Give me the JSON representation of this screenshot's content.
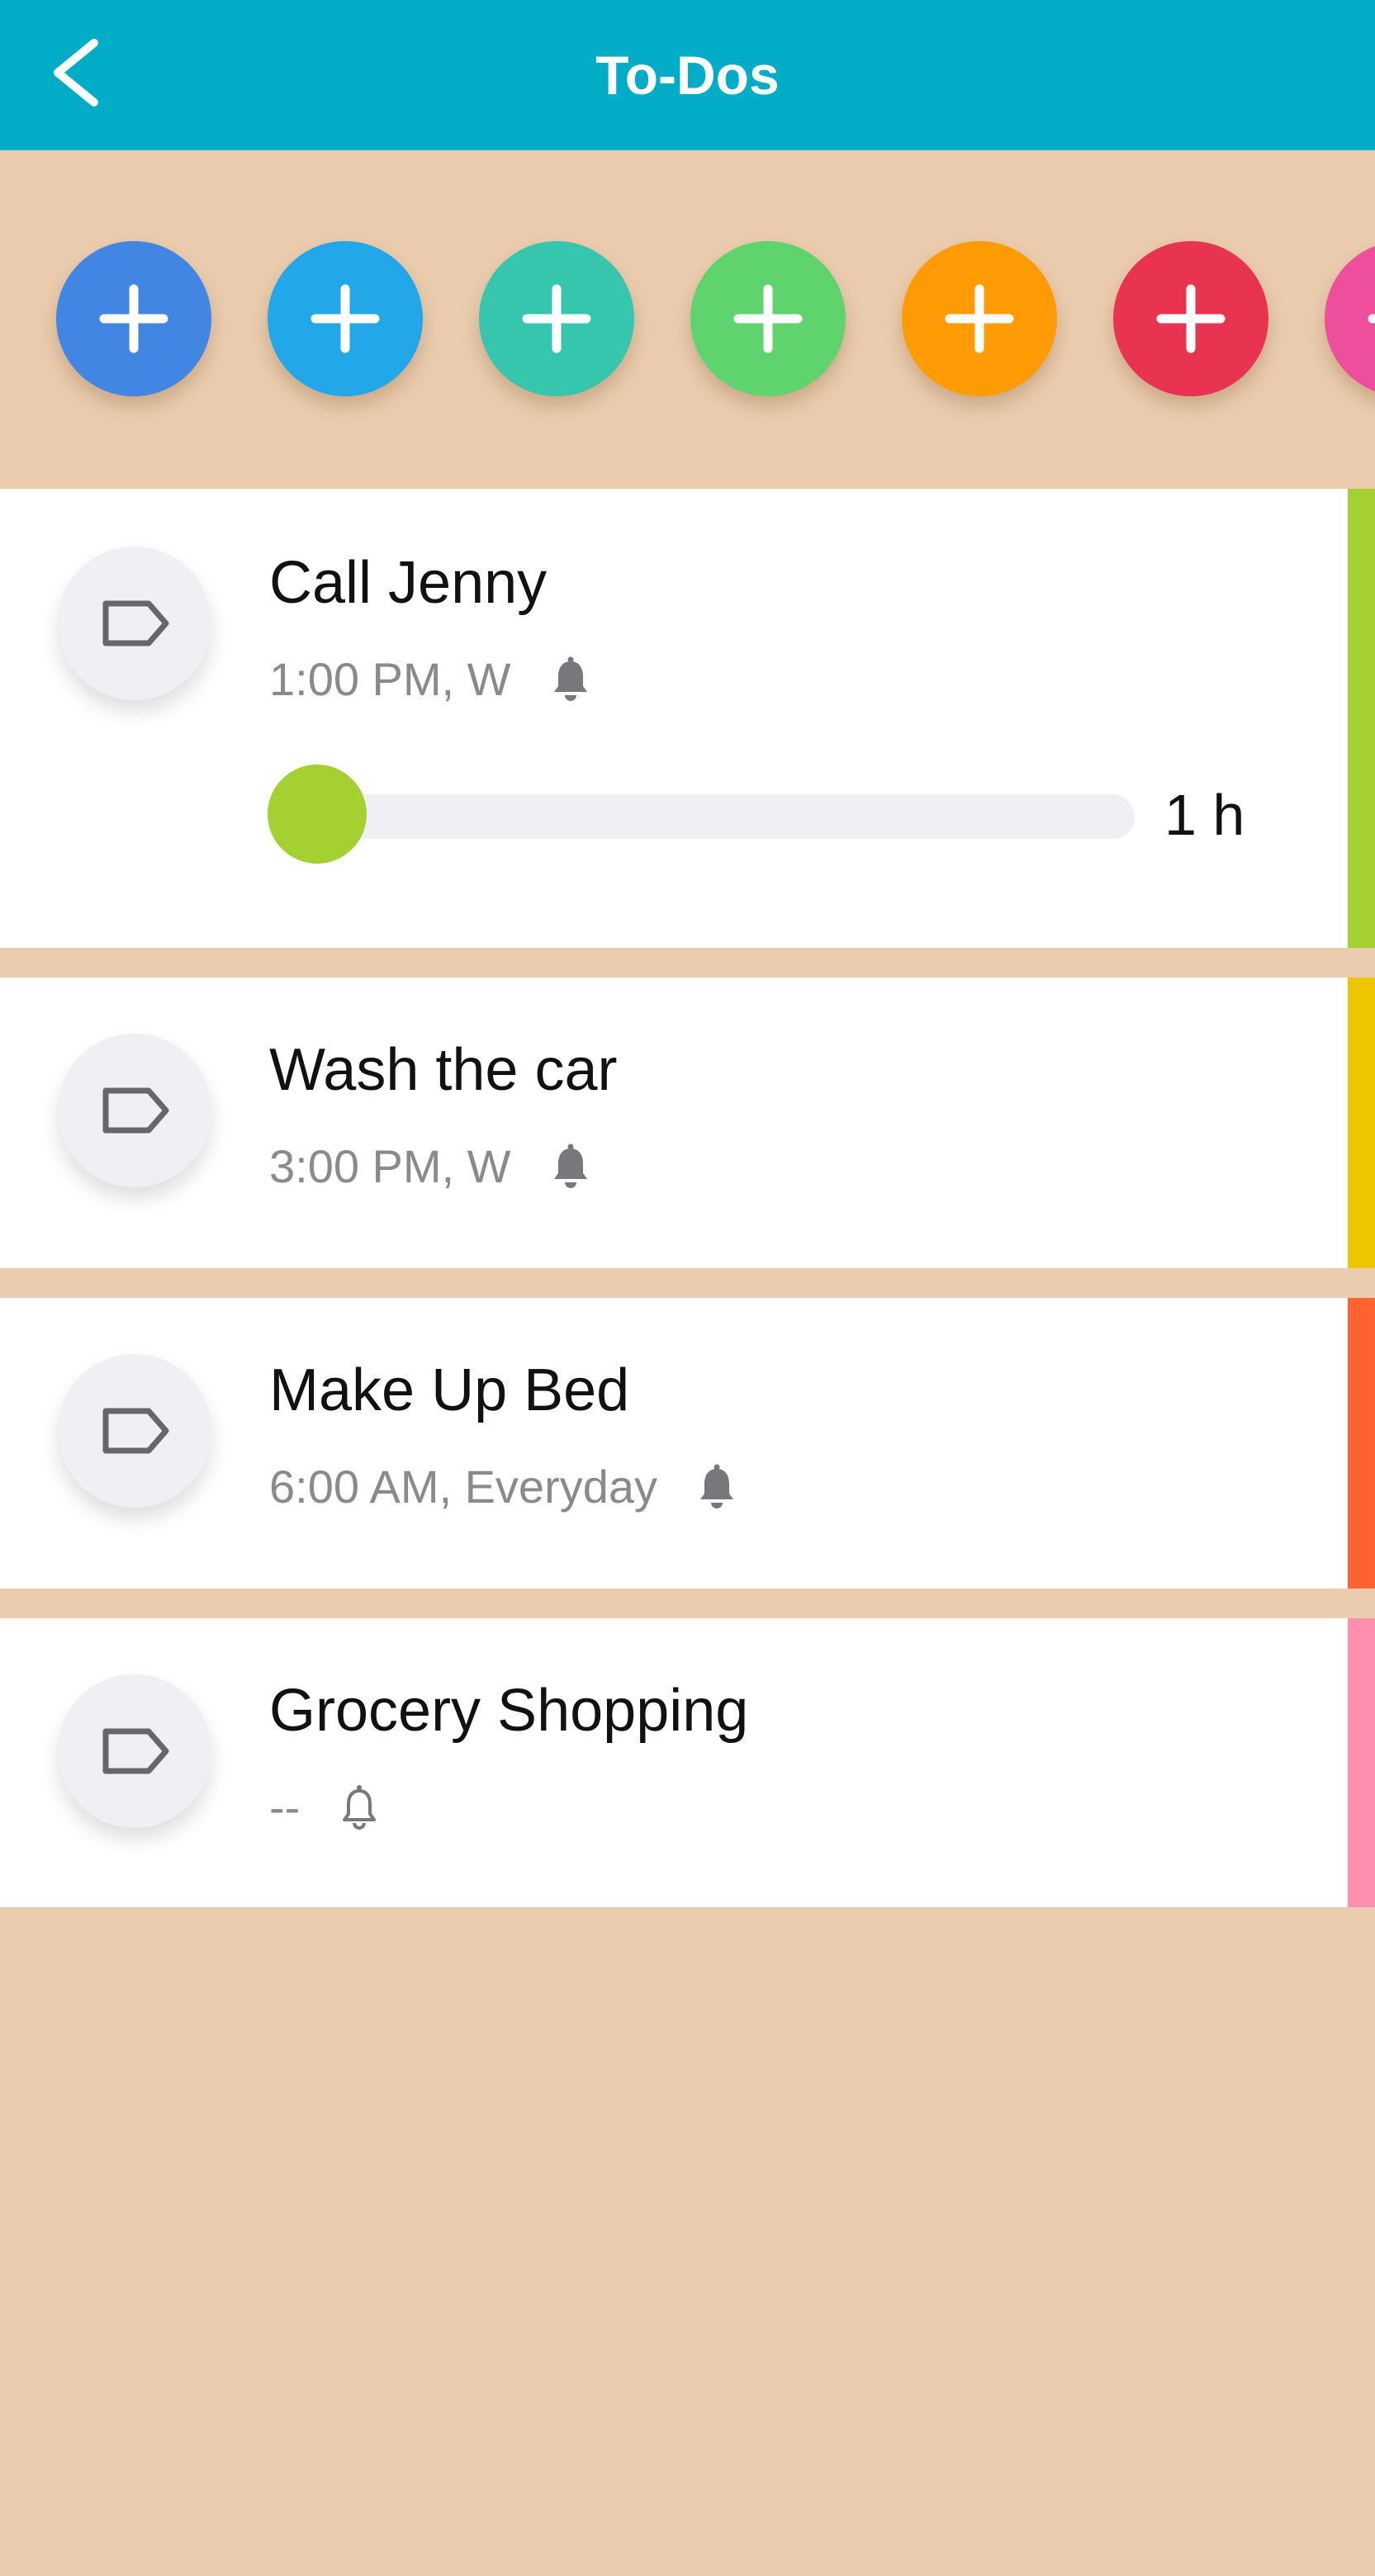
{
  "header": {
    "title": "To-Dos",
    "back_icon": "chevron-left-icon",
    "background": "#00ACC6"
  },
  "color_strip": {
    "background": "#EBCCAE",
    "buttons": [
      {
        "color": "#4186E2",
        "icon": "plus-icon"
      },
      {
        "color": "#22A8E8",
        "icon": "plus-icon"
      },
      {
        "color": "#36C6AE",
        "icon": "plus-icon"
      },
      {
        "color": "#5FD46E",
        "icon": "plus-icon"
      },
      {
        "color": "#FF9C05",
        "icon": "plus-icon"
      },
      {
        "color": "#E83450",
        "icon": "plus-icon"
      },
      {
        "color": "#EE4F9D",
        "icon": "plus-icon"
      }
    ]
  },
  "todos": [
    {
      "title": "Call Jenny",
      "schedule": "1:00 PM, W",
      "reminder_icon": "bell-filled-icon",
      "color": "#A5D032",
      "progress": 0,
      "duration": "1 h"
    },
    {
      "title": "Wash the car",
      "schedule": "3:00 PM, W",
      "reminder_icon": "bell-filled-icon",
      "color": "#EEC600"
    },
    {
      "title": "Make Up Bed",
      "schedule": "6:00 AM, Everyday",
      "reminder_icon": "bell-filled-icon",
      "color": "#FF6331"
    },
    {
      "title": "Grocery Shopping",
      "schedule": "--",
      "reminder_icon": "bell-outline-icon",
      "color": "#FF8FAF"
    }
  ]
}
